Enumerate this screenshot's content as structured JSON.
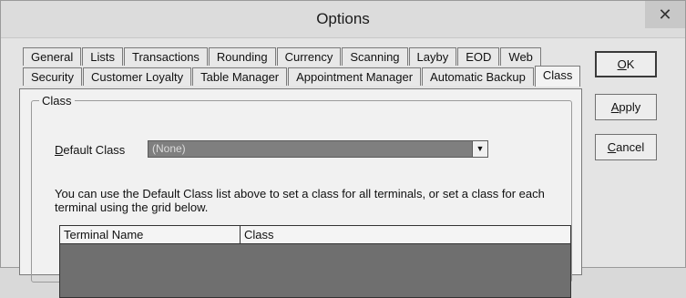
{
  "window": {
    "title": "Options",
    "close_glyph": "✕"
  },
  "tabs": {
    "row1": [
      "General",
      "Lists",
      "Transactions",
      "Rounding",
      "Currency",
      "Scanning",
      "Layby",
      "EOD",
      "Web"
    ],
    "row2": [
      "Security",
      "Customer Loyalty",
      "Table Manager",
      "Appointment Manager",
      "Automatic Backup",
      "Class"
    ],
    "active": "Class"
  },
  "class_group": {
    "legend": "Class",
    "default_class_label_first": "D",
    "default_class_label_rest": "efault Class",
    "default_class_value": "(None)",
    "help_text": "You can use the Default Class list above to set a class for all terminals, or set a class for each terminal using the grid below.",
    "grid_columns": [
      "Terminal Name",
      "Class"
    ]
  },
  "buttons": {
    "ok_first": "O",
    "ok_rest": "K",
    "apply_first": "A",
    "apply_rest": "pply",
    "cancel_first": "C",
    "cancel_rest": "ancel"
  },
  "icons": {
    "dropdown": "chevron-down-icon",
    "close": "close-icon"
  }
}
